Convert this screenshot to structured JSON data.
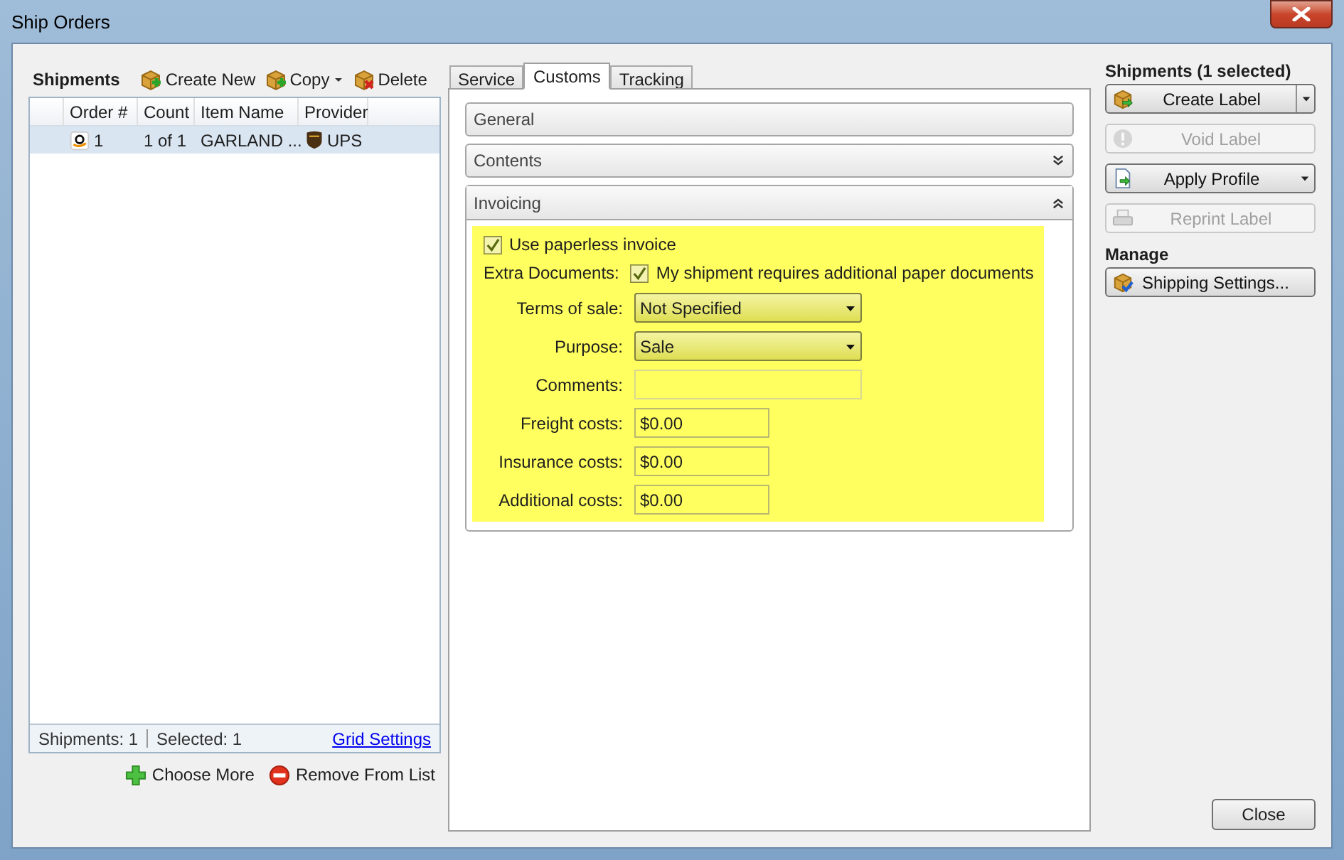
{
  "window": {
    "title": "Ship Orders"
  },
  "shipments_panel": {
    "title": "Shipments",
    "toolbar": [
      {
        "label": "Create New",
        "kind": "add",
        "dropdown": false
      },
      {
        "label": "Copy",
        "kind": "copy",
        "dropdown": true
      },
      {
        "label": "Delete",
        "kind": "delete",
        "dropdown": false
      }
    ],
    "grid": {
      "columns": [
        "Order #",
        "Count",
        "Item Name",
        "Provider"
      ],
      "rows": [
        {
          "order": "1",
          "count": "1 of 1",
          "item_name": "GARLAND ...",
          "provider": "UPS",
          "selected": true
        }
      ]
    },
    "footer": {
      "shipments": "Shipments: 1",
      "selected": "Selected: 1",
      "link": "Grid Settings"
    },
    "actions": [
      {
        "label": "Choose More",
        "kind": "add"
      },
      {
        "label": "Remove From List",
        "kind": "remove"
      }
    ]
  },
  "tabs": [
    {
      "label": "Service",
      "selected": false
    },
    {
      "label": "Customs",
      "selected": true
    },
    {
      "label": "Tracking",
      "selected": false
    }
  ],
  "sections": [
    {
      "title": "General"
    },
    {
      "title": "Contents",
      "expanded": false
    },
    {
      "title": "Invoicing",
      "expanded": true
    }
  ],
  "invoicing": {
    "paperless": {
      "label": "Use paperless invoice",
      "checked": true
    },
    "fields": [
      {
        "kind": "checkbox",
        "label": "Extra Documents:",
        "text": "My shipment requires additional paper documents",
        "checked": true
      },
      {
        "kind": "select",
        "label": "Terms of sale:",
        "value": "Not Specified"
      },
      {
        "kind": "select",
        "label": "Purpose:",
        "value": "Sale"
      },
      {
        "kind": "text",
        "label": "Comments:",
        "disabled": true
      },
      {
        "kind": "text",
        "label": "Freight costs:",
        "value": "$0.00",
        "disabled": false
      },
      {
        "kind": "text",
        "label": "Insurance costs:",
        "value": "$0.00",
        "disabled": false
      },
      {
        "kind": "text",
        "label": "Additional costs:",
        "value": "$0.00",
        "disabled": false
      }
    ]
  },
  "actions_panel": {
    "title": "Shipments (1 selected)",
    "buttons": [
      {
        "label": "Create Label",
        "kind": "split",
        "disabled": false
      },
      {
        "label": "Void Label",
        "kind": "plain",
        "disabled": true
      },
      {
        "label": "Apply Profile",
        "kind": "dropdown",
        "disabled": false
      },
      {
        "label": "Reprint Label",
        "kind": "plain",
        "disabled": true
      }
    ],
    "manage_title": "Manage",
    "manage_buttons": [
      {
        "label": "Shipping Settings...",
        "kind": "plain",
        "disabled": false
      }
    ]
  },
  "close_button": "Close"
}
